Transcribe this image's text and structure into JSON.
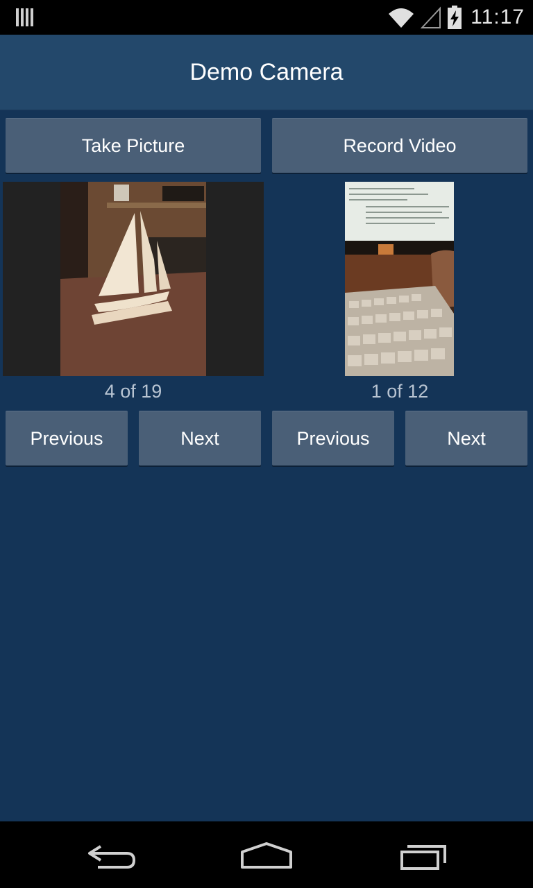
{
  "status_bar": {
    "time": "11:17",
    "icons": [
      "signal-bars-icon",
      "wifi-icon",
      "cell-signal-icon",
      "battery-charging-icon"
    ]
  },
  "app": {
    "title": "Demo Camera"
  },
  "actions": {
    "take_picture": "Take Picture",
    "record_video": "Record Video"
  },
  "photo_gallery": {
    "counter": "4 of 19",
    "previous": "Previous",
    "next": "Next"
  },
  "video_gallery": {
    "counter": "1 of 12",
    "previous": "Previous",
    "next": "Next"
  },
  "nav_bar": {
    "icons": [
      "back-icon",
      "home-icon",
      "recent-apps-icon"
    ]
  },
  "colors": {
    "background": "#143457",
    "app_bar": "#23486b",
    "button": "#4a5f77",
    "counter_text": "#b8c4d2"
  }
}
